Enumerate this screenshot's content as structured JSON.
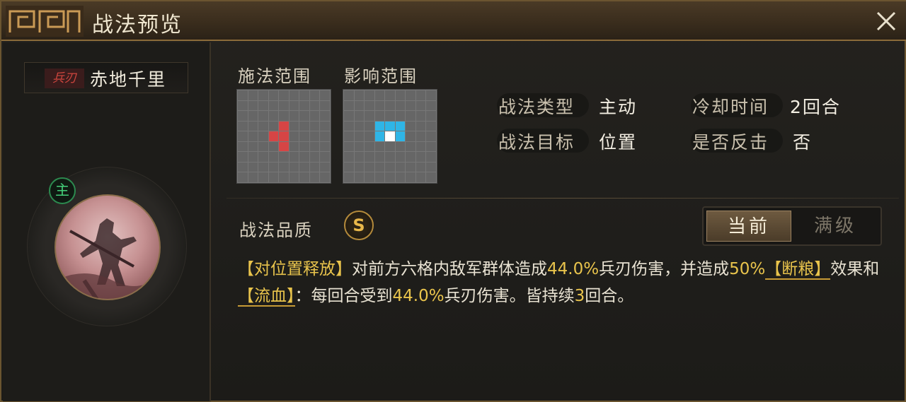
{
  "window": {
    "title": "战法预览",
    "close": "×"
  },
  "skill": {
    "type_tag": "兵刃",
    "name": "赤地千里",
    "badge": "主"
  },
  "range": {
    "cast_label": "施法范围",
    "effect_label": "影响范围",
    "cast_grid": {
      "size": 9,
      "red": [
        [
          3,
          4
        ],
        [
          4,
          3
        ],
        [
          4,
          4
        ],
        [
          5,
          4
        ]
      ]
    },
    "effect_grid": {
      "size": 9,
      "blue": [
        [
          3,
          3
        ],
        [
          3,
          4
        ],
        [
          3,
          5
        ],
        [
          4,
          3
        ],
        [
          4,
          5
        ]
      ],
      "white": [
        [
          4,
          4
        ]
      ]
    }
  },
  "info": {
    "type_key": "战法类型",
    "type_val": "主动",
    "cooldown_key": "冷却时间",
    "cooldown_val": "2回合",
    "target_key": "战法目标",
    "target_val": "位置",
    "counter_key": "是否反击",
    "counter_val": "否"
  },
  "quality": {
    "label": "战法品质",
    "grade": "S"
  },
  "toggle": {
    "current": "当前",
    "max": "满级"
  },
  "description": {
    "p1": "【对位置释放】",
    "p2": "对前方六格内敌军群体造成",
    "p3": "44.0%",
    "p4": "兵刃伤害，并造成",
    "p5": "50%",
    "p6": "【断粮】",
    "p7": "效果和",
    "p8": "【流血】",
    "p9": "：每回合受到",
    "p10": "44.0%",
    "p11": "兵刃伤害。皆持续",
    "p12": "3",
    "p13": "回合。"
  },
  "colors": {
    "accent_gold": "#e9c44c",
    "range_red": "#d64545",
    "range_blue": "#2fb5e6",
    "main_badge_green": "#44d07a"
  }
}
